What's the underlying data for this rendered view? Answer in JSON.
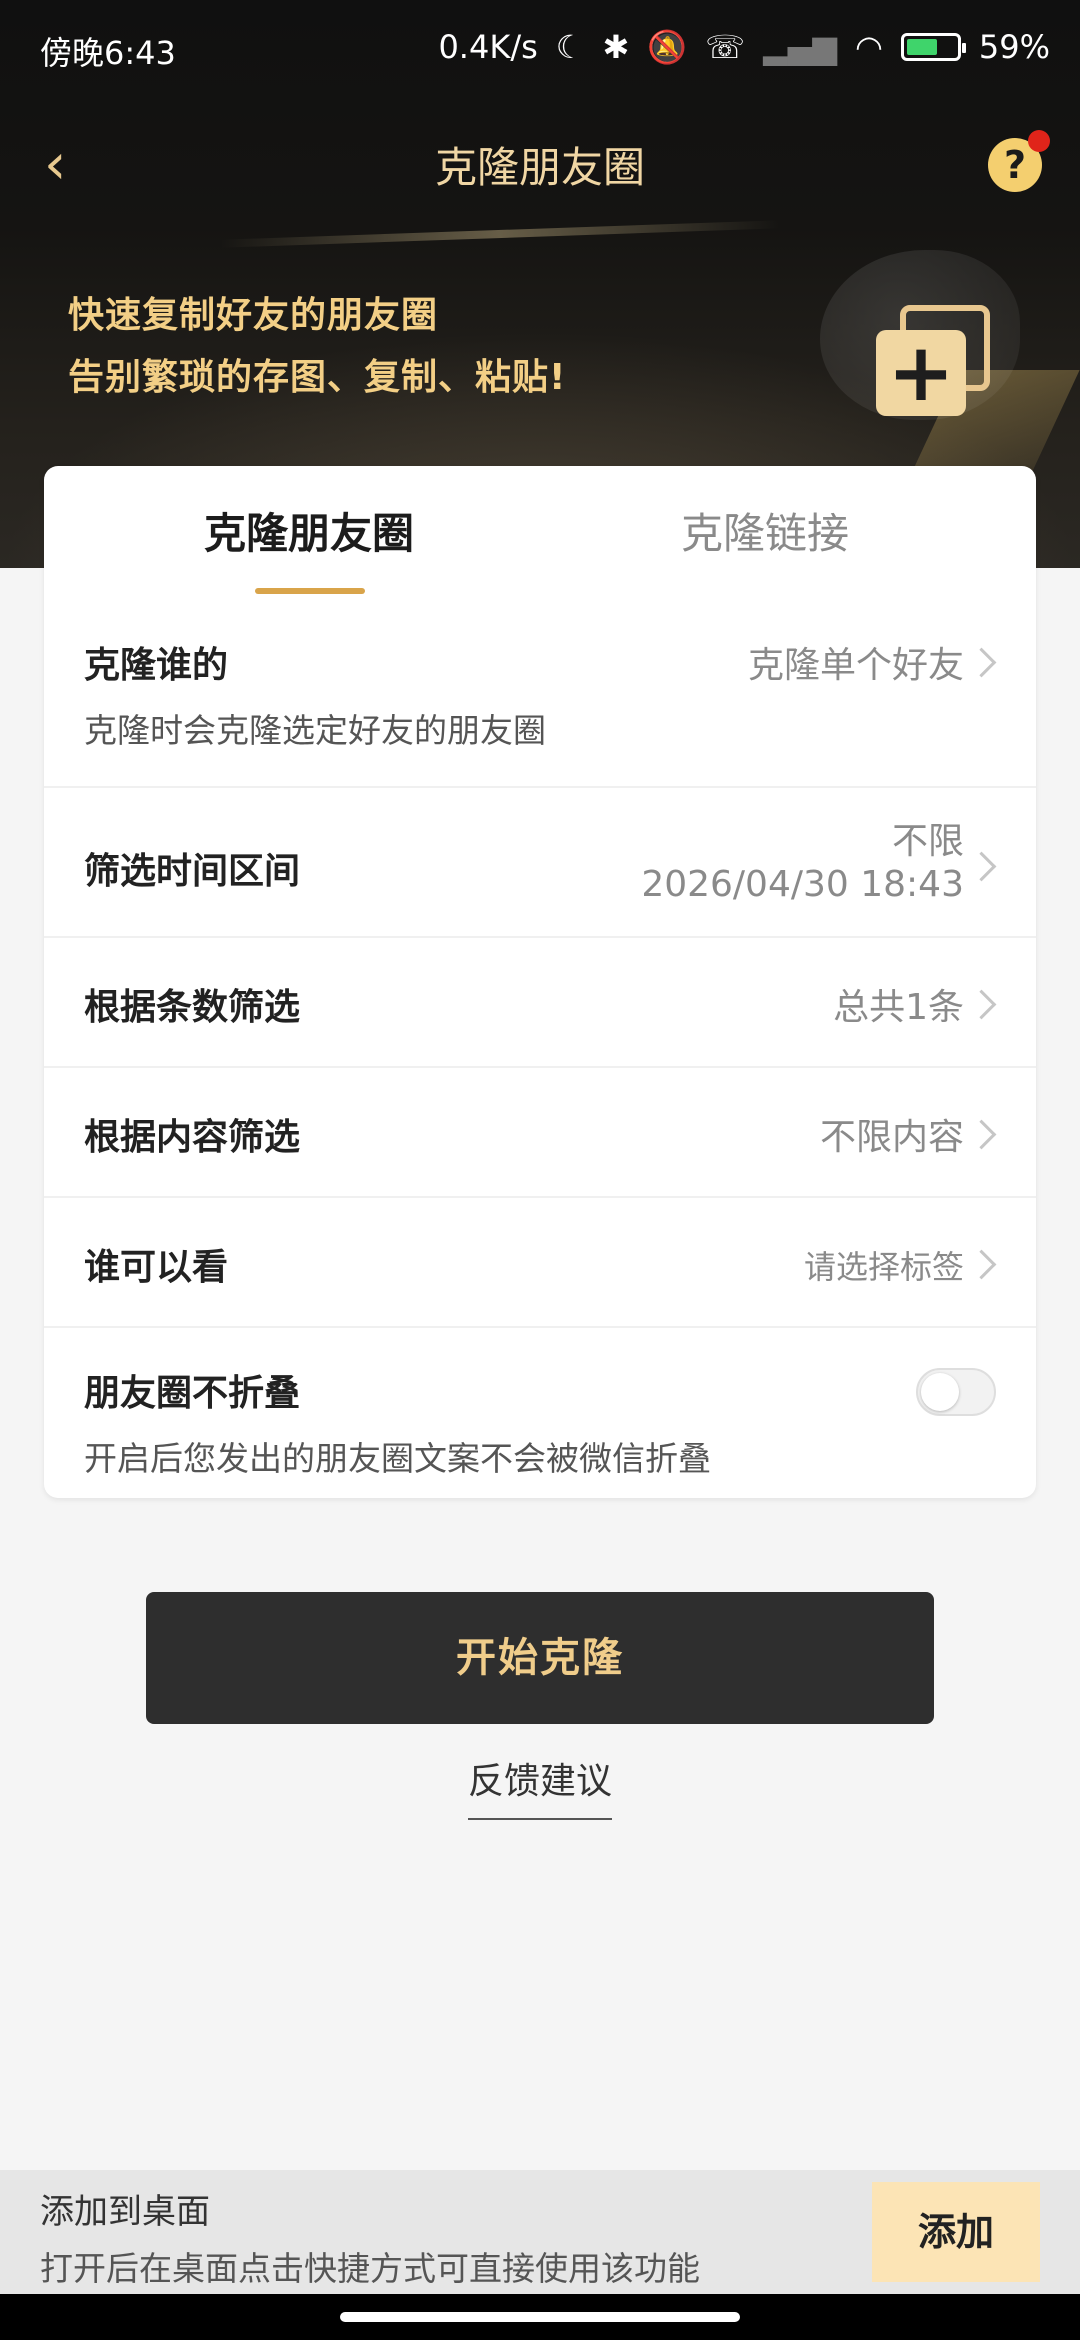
{
  "status_bar": {
    "time": "傍晚6:43",
    "network_speed": "0.4K/s",
    "icons": [
      "moon-icon",
      "bluetooth-icon",
      "mute-bell-icon",
      "call-icon",
      "signal-icon",
      "wifi-icon",
      "battery-icon"
    ],
    "battery": "59%"
  },
  "header": {
    "title": "克隆朋友圈",
    "back_icon": "chevron-left-icon",
    "help_label": "?"
  },
  "hero": {
    "line1": "快速复制好友的朋友圈",
    "line2": "告别繁琐的存图、复制、粘贴!"
  },
  "tabs": [
    {
      "label": "克隆朋友圈",
      "active": true
    },
    {
      "label": "克隆链接",
      "active": false
    }
  ],
  "settings": {
    "clone_who": {
      "label": "克隆谁的",
      "value": "克隆单个好友",
      "desc": "克隆时会克隆选定好友的朋友圈"
    },
    "time_range": {
      "label": "筛选时间区间",
      "value_line1": "不限",
      "value_line2": "2026/04/30 18:43"
    },
    "count_filter": {
      "label": "根据条数筛选",
      "value": "总共1条"
    },
    "content_filter": {
      "label": "根据内容筛选",
      "value": "不限内容"
    },
    "visibility": {
      "label": "谁可以看",
      "value": "请选择标签"
    },
    "no_fold": {
      "label": "朋友圈不折叠",
      "desc": "开启后您发出的朋友圈文案不会被微信折叠",
      "enabled": false
    }
  },
  "actions": {
    "start": "开始克隆",
    "feedback": "反馈建议"
  },
  "shortcut_bar": {
    "title": "添加到桌面",
    "desc": "打开后在桌面点击快捷方式可直接使用该功能",
    "button": "添加"
  },
  "colors": {
    "accent_gold": "#d9a44a",
    "title_gold": "#f0d6a4",
    "button_dark": "#2e2e2e",
    "add_button_bg": "#fce4b5"
  }
}
